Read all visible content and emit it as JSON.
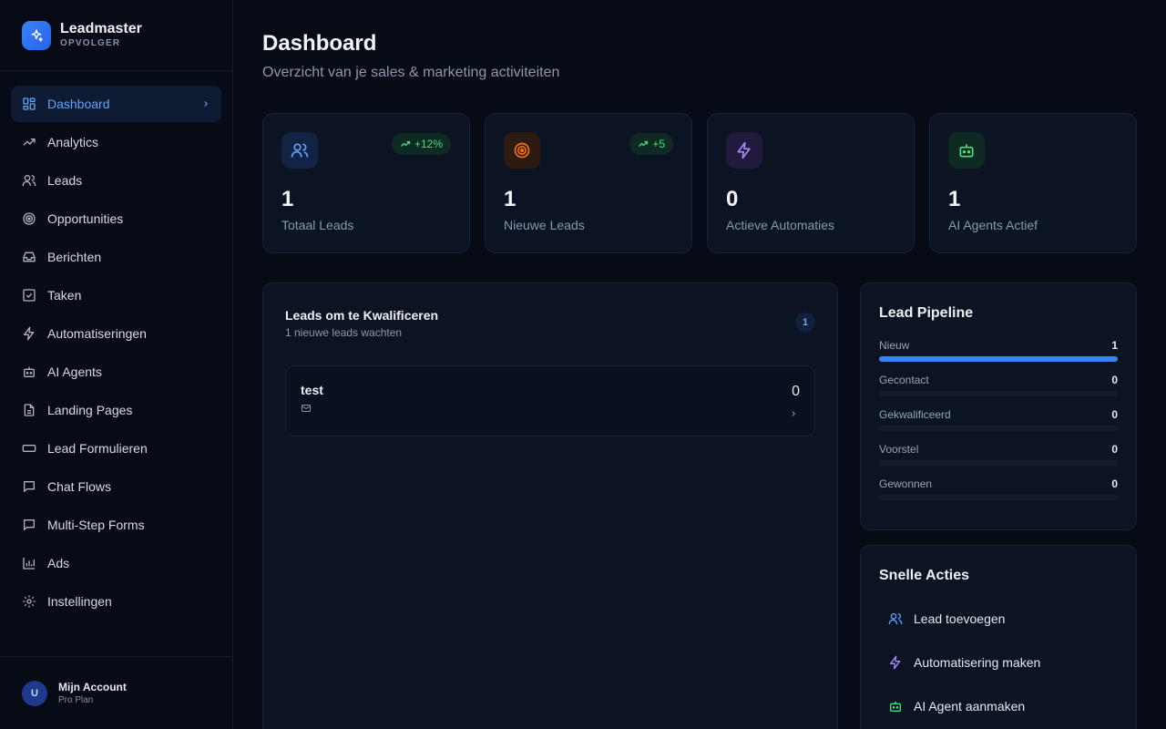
{
  "brand": {
    "name": "Leadmaster",
    "sub": "OPVOLGER",
    "icon": "sparkle-icon"
  },
  "sidebar": {
    "items": [
      {
        "label": "Dashboard",
        "icon": "grid-icon",
        "active": true
      },
      {
        "label": "Analytics",
        "icon": "trending-up-icon"
      },
      {
        "label": "Leads",
        "icon": "users-icon"
      },
      {
        "label": "Opportunities",
        "icon": "target-icon"
      },
      {
        "label": "Berichten",
        "icon": "inbox-icon"
      },
      {
        "label": "Taken",
        "icon": "check-square-icon"
      },
      {
        "label": "Automatiseringen",
        "icon": "zap-icon"
      },
      {
        "label": "AI Agents",
        "icon": "bot-icon"
      },
      {
        "label": "Landing Pages",
        "icon": "file-icon"
      },
      {
        "label": "Lead Formulieren",
        "icon": "form-icon"
      },
      {
        "label": "Chat Flows",
        "icon": "chat-icon"
      },
      {
        "label": "Multi-Step Forms",
        "icon": "chat-icon"
      },
      {
        "label": "Ads",
        "icon": "bar-chart-icon"
      },
      {
        "label": "Instellingen",
        "icon": "settings-icon"
      }
    ]
  },
  "account": {
    "initial": "U",
    "name": "Mijn Account",
    "plan": "Pro Plan"
  },
  "header": {
    "title": "Dashboard",
    "subtitle": "Overzicht van je sales & marketing activiteiten"
  },
  "stats": [
    {
      "value": "1",
      "label": "Totaal Leads",
      "badge": "+12%",
      "icon": "users-icon",
      "color": "#60a5fa"
    },
    {
      "value": "1",
      "label": "Nieuwe Leads",
      "badge": "+5",
      "icon": "target-icon",
      "color": "#f97316"
    },
    {
      "value": "0",
      "label": "Actieve Automaties",
      "badge": "",
      "icon": "zap-icon",
      "color": "#a78bfa"
    },
    {
      "value": "1",
      "label": "AI Agents Actief",
      "badge": "",
      "icon": "bot-icon",
      "color": "#4ade80"
    }
  ],
  "leads_panel": {
    "title": "Leads om te Kwalificeren",
    "subtitle": "1 nieuwe leads wachten",
    "count": "1",
    "leads": [
      {
        "name": "test",
        "score": "0"
      }
    ]
  },
  "pipeline": {
    "title": "Lead Pipeline",
    "stages": [
      {
        "name": "Nieuw",
        "count": "1",
        "fraction": 1.0
      },
      {
        "name": "Gecontact",
        "count": "0",
        "fraction": 0
      },
      {
        "name": "Gekwalificeerd",
        "count": "0",
        "fraction": 0
      },
      {
        "name": "Voorstel",
        "count": "0",
        "fraction": 0
      },
      {
        "name": "Gewonnen",
        "count": "0",
        "fraction": 0
      }
    ]
  },
  "quick_actions": {
    "title": "Snelle Acties",
    "items": [
      {
        "label": "Lead toevoegen",
        "icon": "users-icon",
        "color": "#60a5fa"
      },
      {
        "label": "Automatisering maken",
        "icon": "zap-icon",
        "color": "#a78bfa"
      },
      {
        "label": "AI Agent aanmaken",
        "icon": "bot-icon",
        "color": "#4ade80"
      }
    ]
  }
}
